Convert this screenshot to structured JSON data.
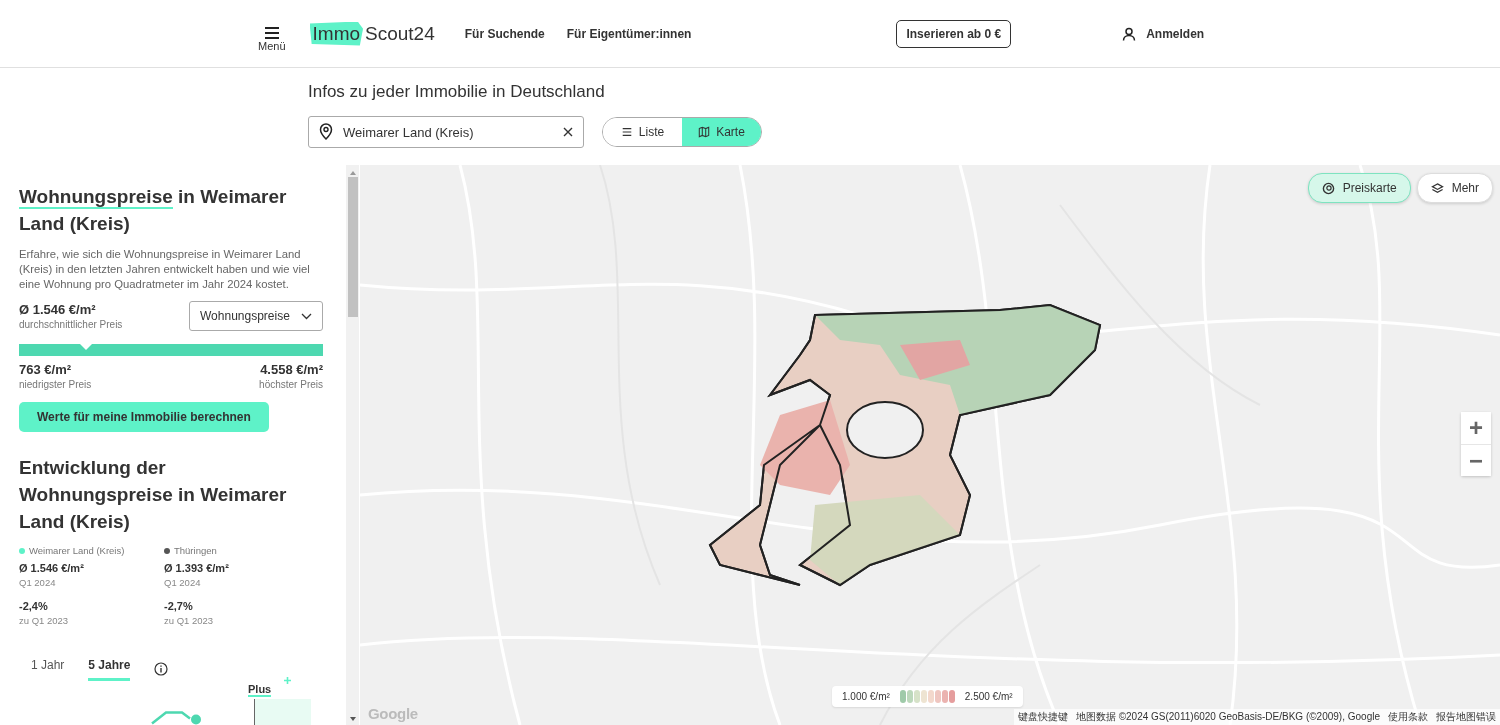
{
  "header": {
    "menu_label": "Menü",
    "logo_highlight": "Immo",
    "logo_rest": "Scout24",
    "nav": [
      "Für Suchende",
      "Für Eigentümer:innen"
    ],
    "cta": "Inserieren ab 0 €",
    "login": "Anmelden"
  },
  "page_title": "Infos zu jeder Immobilie in Deutschland",
  "search": {
    "value": "Weimarer Land (Kreis)"
  },
  "view_toggle": [
    {
      "label": "Liste",
      "kind": "list",
      "selected": false
    },
    {
      "label": "Karte",
      "kind": "map",
      "selected": true
    }
  ],
  "panel": {
    "heading_highlight": "Wohnungspreise",
    "heading_rest": " in Weimarer Land (Kreis)",
    "description": "Erfahre, wie sich die Wohnungspreise in Weimarer Land (Kreis) in den letzten Jahren entwickelt haben und wie viel eine Wohnung pro Quadratmeter im Jahr 2024 kostet.",
    "avg_price": "Ø 1.546 €/m²",
    "avg_label": "durchschnittlicher Preis",
    "dropdown": "Wohnungspreise",
    "range": {
      "level": 0.22,
      "min": "763 €/m²",
      "min_label": "niedrigster Preis",
      "max": "4.558 €/m²",
      "max_label": "höchster Preis"
    },
    "button": "Werte für meine Immobilie berechnen"
  },
  "development": {
    "heading": "Entwicklung der Wohnungspreise in Weimarer Land (Kreis)",
    "regions": [
      {
        "name": "Weimarer Land (Kreis)",
        "color": "#5ef2c8",
        "price": "Ø 1.546 €/m²",
        "period": "Q1 2024",
        "change": "-2,4%",
        "change_label": "zu Q1 2023"
      },
      {
        "name": "Thüringen",
        "color": "#555555",
        "price": "Ø 1.393 €/m²",
        "period": "Q1 2024",
        "change": "-2,7%",
        "change_label": "zu Q1 2023"
      }
    ],
    "tabs": [
      {
        "label": "1 Jahr",
        "selected": false
      },
      {
        "label": "5 Jahre",
        "selected": true
      }
    ],
    "plus": "Plus"
  },
  "map": {
    "controls": [
      {
        "label": "Preiskarte",
        "kind": "price",
        "selected": true
      },
      {
        "label": "Mehr",
        "kind": "layers",
        "selected": false
      }
    ],
    "zoom": [
      "+",
      "−"
    ],
    "legend": {
      "min": "1.000 €/m²",
      "max": "2.500 €/m²",
      "swatches": [
        {
          "color": "#9fcaa9"
        },
        {
          "color": "#bcd8bb"
        },
        {
          "color": "#d6e2c8"
        },
        {
          "color": "#eee4d2"
        },
        {
          "color": "#f3d8cc"
        },
        {
          "color": "#efc6c0"
        },
        {
          "color": "#ebb3b0"
        },
        {
          "color": "#e59d9d"
        }
      ]
    },
    "google": "Google",
    "attribution": [
      "键盘快捷键",
      "地图数据 ©2024 GS(2011)6020 GeoBasis-DE/BKG (©2009), Google",
      "使用条款",
      "报告地图错误"
    ]
  }
}
